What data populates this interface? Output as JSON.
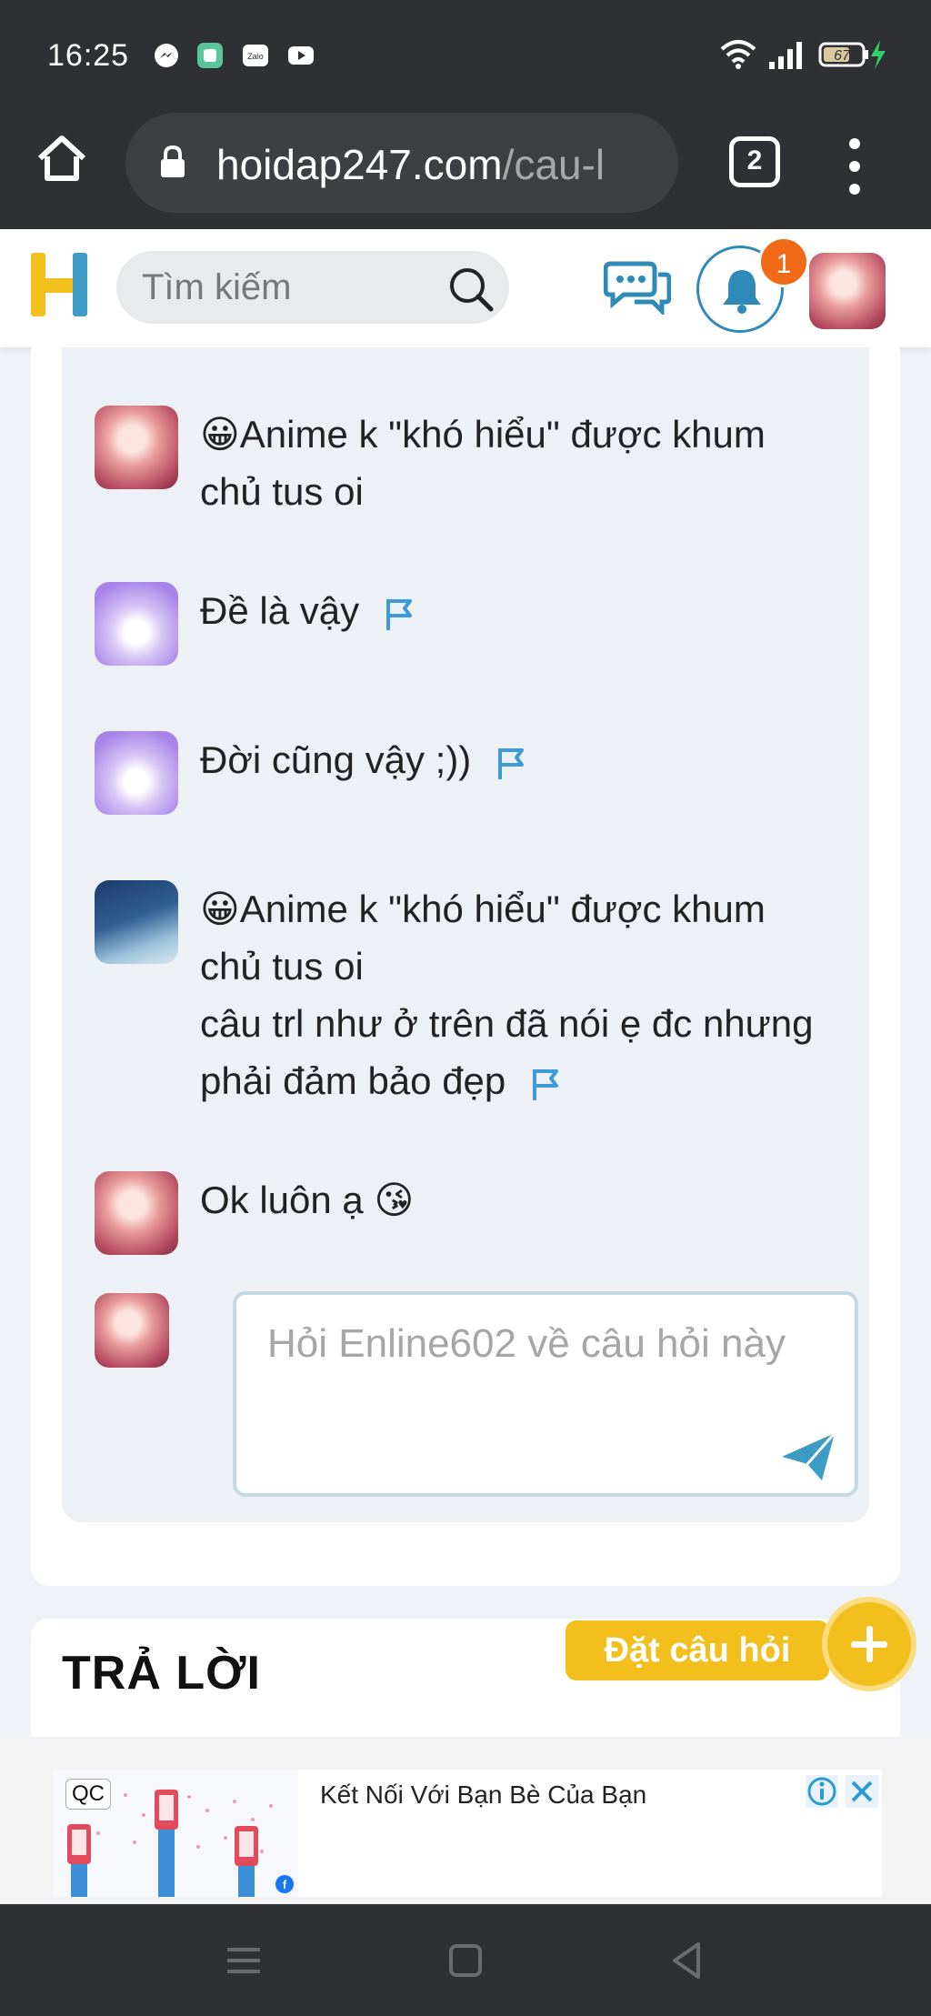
{
  "status_bar": {
    "time": "16:25",
    "battery": "67"
  },
  "browser": {
    "url_domain": "hoidap247.com",
    "url_path": "/cau-l",
    "tab_count": "2"
  },
  "header": {
    "search_placeholder": "Tìm kiếm",
    "notification_count": "1"
  },
  "comments": [
    {
      "text": "😀Anime k \"khó hiểu\" được khum chủ tus oi",
      "flag": false
    },
    {
      "text": "Đề là vậy",
      "flag": true
    },
    {
      "text": "Đời cũng vậy ;))",
      "flag": true
    },
    {
      "text": "😀Anime k \"khó hiểu\" được khum chủ tus oi\ncâu trl như ở trên đã nói ẹ đc nhưng phải đảm bảo đẹp",
      "flag": true
    },
    {
      "text": "Ok luôn ạ 😘",
      "flag": false
    }
  ],
  "reply": {
    "placeholder": "Hỏi Enline602 về câu hỏi này"
  },
  "answer_section": {
    "title": "TRẢ LỜI"
  },
  "ask_button": {
    "label": "Đặt câu hỏi"
  },
  "ad": {
    "badge": "QC",
    "title": "Kết Nối Với Bạn Bè Của Bạn"
  },
  "colors": {
    "accent_blue": "#2e8ab8",
    "accent_yellow": "#f2bf1c",
    "badge_orange": "#f06a18",
    "dark_bar": "#2f3033"
  }
}
